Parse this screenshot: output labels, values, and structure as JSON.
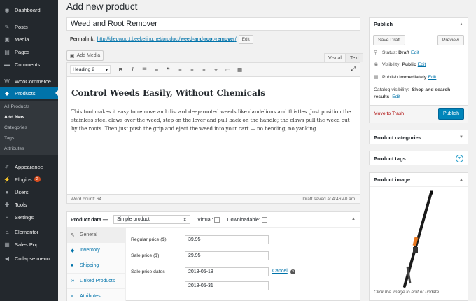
{
  "sidebar": {
    "items": [
      {
        "label": "Dashboard",
        "icon": "gauge-icon",
        "glyph": "◉"
      },
      {
        "label": "Posts",
        "icon": "pin-icon",
        "glyph": "✎"
      },
      {
        "label": "Media",
        "icon": "media-icon",
        "glyph": "▣"
      },
      {
        "label": "Pages",
        "icon": "page-icon",
        "glyph": "▤"
      },
      {
        "label": "Comments",
        "icon": "comment-icon",
        "glyph": "▬"
      },
      {
        "label": "WooCommerce",
        "icon": "woo-icon",
        "glyph": "W"
      },
      {
        "label": "Products",
        "icon": "products-icon",
        "glyph": "◆"
      },
      {
        "label": "Appearance",
        "icon": "brush-icon",
        "glyph": "✐"
      },
      {
        "label": "Plugins",
        "icon": "plugin-icon",
        "glyph": "⚡",
        "badge": "2"
      },
      {
        "label": "Users",
        "icon": "users-icon",
        "glyph": "●"
      },
      {
        "label": "Tools",
        "icon": "wrench-icon",
        "glyph": "✚"
      },
      {
        "label": "Settings",
        "icon": "sliders-icon",
        "glyph": "≡"
      },
      {
        "label": "Elementor",
        "icon": "elementor-icon",
        "glyph": "E"
      },
      {
        "label": "Sales Pop",
        "icon": "salespop-icon",
        "glyph": "▦"
      },
      {
        "label": "Collapse menu",
        "icon": "collapse-icon",
        "glyph": "◀"
      }
    ],
    "products_sub": [
      "All Products",
      "Add New",
      "Categories",
      "Tags",
      "Attributes"
    ]
  },
  "page": {
    "title": "Add new product",
    "product_title": "Weed and Root Remover",
    "permalink_label": "Permalink:",
    "permalink_url": "http://diepwoo.t.beeketing.net/product/",
    "permalink_slug": "weed-and-root-remover",
    "permalink_tail": "/",
    "edit_label": "Edit"
  },
  "editor": {
    "add_media": "Add Media",
    "tab_visual": "Visual",
    "tab_text": "Text",
    "format_select": "Heading 2",
    "heading": "Control Weeds Easily, Without Chemicals",
    "body": "This tool makes it easy to remove and discard deep-rooted weeds like dandelions and thistles. Just position the stainless steel claws over the weed, step on the lever and pull back on the handle; the claws pull the weed out by the roots. Then just push the grip and eject the weed into your cart — no bending, no yanking",
    "word_count": "Word count: 64",
    "draft_saved": "Draft saved at 4:46:40 am."
  },
  "product_data": {
    "label": "Product data —",
    "type": "Simple product",
    "virtual_label": "Virtual:",
    "downloadable_label": "Downloadable:",
    "tabs": [
      {
        "label": "General",
        "icon": "wrench-icon",
        "glyph": "✎"
      },
      {
        "label": "Inventory",
        "icon": "inventory-icon",
        "glyph": "◆"
      },
      {
        "label": "Shipping",
        "icon": "truck-icon",
        "glyph": "■"
      },
      {
        "label": "Linked Products",
        "icon": "link-icon",
        "glyph": "∞"
      },
      {
        "label": "Attributes",
        "icon": "list-icon",
        "glyph": "≡"
      }
    ],
    "regular_price_label": "Regular price ($)",
    "regular_price": "39.95",
    "sale_price_label": "Sale price ($)",
    "sale_price": "29.95",
    "sale_dates_label": "Sale price dates",
    "sale_from": "2018-05-18",
    "sale_to": "2018-05-31",
    "cancel_label": "Cancel"
  },
  "publish": {
    "title": "Publish",
    "save_draft": "Save Draft",
    "preview": "Preview",
    "status_label": "Status:",
    "status_value": "Draft",
    "visibility_label": "Visibility:",
    "visibility_value": "Public",
    "publish_label": "Publish",
    "publish_value": "immediately",
    "edit": "Edit",
    "catalog_label": "Catalog visibility:",
    "catalog_value": "Shop and search results",
    "trash": "Move to Trash",
    "publish_button": "Publish"
  },
  "boxes": {
    "categories": "Product categories",
    "tags": "Product tags",
    "image": "Product image",
    "image_caption": "Click the image to edit or update"
  },
  "colors": {
    "sidebar_bg": "#23282d",
    "accent": "#0073aa",
    "publish_button": "#0085ba",
    "trash": "#a00000"
  }
}
